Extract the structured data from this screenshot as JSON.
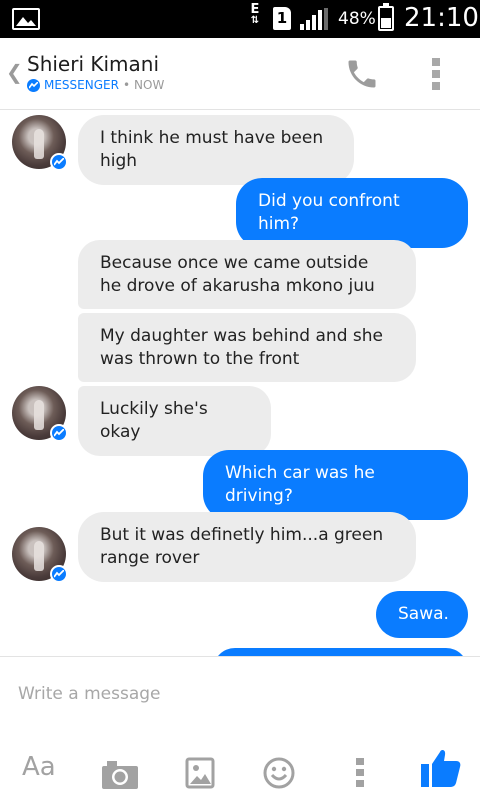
{
  "status_bar": {
    "network": "E",
    "sim": "1",
    "battery": "48%",
    "battery_level": 0.48,
    "time": "21:10"
  },
  "header": {
    "contact_name": "Shieri Kimani",
    "app_label": "MESSENGER",
    "separator": "•",
    "presence": "NOW",
    "back_icon": "chevron-left-icon",
    "call_icon": "phone-icon",
    "menu_icon": "more-vertical-icon"
  },
  "messages": [
    {
      "from": "contact",
      "text": "I think he must have been high"
    },
    {
      "from": "me",
      "text": "Did you confront him?"
    },
    {
      "from": "contact",
      "text": "Because once we came outside he drove of akarusha mkono juu"
    },
    {
      "from": "contact",
      "text": "My daughter was behind and she was thrown to the front"
    },
    {
      "from": "contact",
      "text": "Luckily she's okay"
    },
    {
      "from": "me",
      "text": "Which car was he driving?"
    },
    {
      "from": "contact",
      "text": "But it was definetly him...a green range rover"
    },
    {
      "from": "me",
      "text": "Sawa."
    }
  ],
  "composer": {
    "placeholder": "Write a message",
    "text_format_label": "Aa",
    "tools": [
      "text-format-icon",
      "camera-icon",
      "gallery-icon",
      "emoji-icon",
      "more-vertical-icon",
      "like-icon"
    ]
  },
  "colors": {
    "accent": "#0a7cff",
    "incoming_bubble": "#ececec",
    "status_bar": "#000000"
  }
}
